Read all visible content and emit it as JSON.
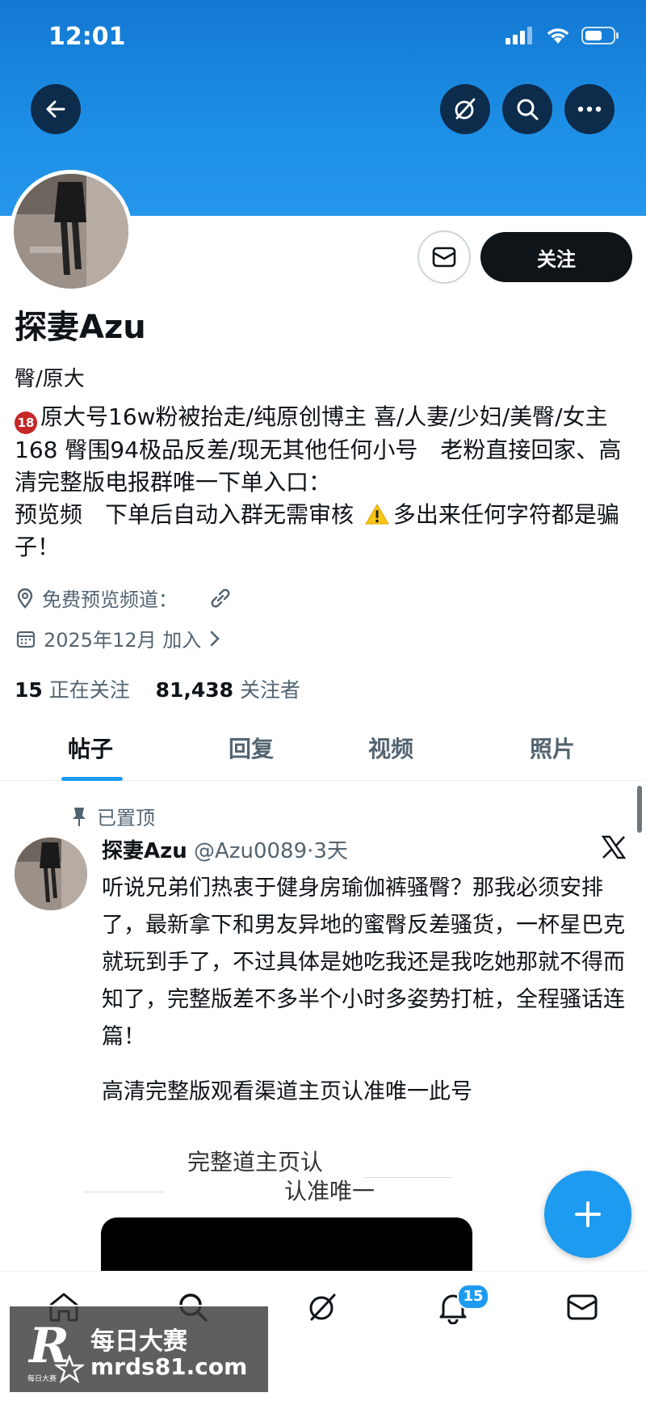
{
  "status_bar": {
    "time": "12:01"
  },
  "profile": {
    "display_name": "探妻Azu",
    "bio_line1": "臀/原大",
    "bio_age_badge": "18",
    "bio_part1": "原大号16w粉被抬走/纯原创博主 喜/人妻/少妇/美臀/女主168 臀围94极品反差/现无其他任何小号　老粉直接回家、高清完整版电报群唯一下单入口：",
    "bio_part2": "预览频　下单后自动入群无需审核",
    "bio_part3": "多出来任何字符都是骗子！",
    "location": "免费预览频道：",
    "joined": "2025年12月 加入",
    "following_count": "15",
    "following_label": "正在关注",
    "followers_count": "81,438",
    "followers_label": "关注者",
    "follow_button": "关注"
  },
  "tabs": [
    "帖子",
    "回复",
    "视频",
    "照片"
  ],
  "post": {
    "pinned_label": "已置顶",
    "name": "探妻Azu",
    "handle_time": "@Azu0089·3天",
    "text": "听说兄弟们热衷于健身房瑜伽裤骚臀？那我必须安排了，最新拿下和男友异地的蜜臀反差骚货，一杯星巴克就玩到手了，不过具体是她吃我还是我吃她那就不得而知了，完整版差不多半个小时多姿势打桩，全程骚话连篇！",
    "extra": "高清完整版观看渠道主页认准唯一此号",
    "media_text1": "完整道主页认",
    "media_text2": "认准唯一"
  },
  "nav": {
    "notifications_badge": "15"
  },
  "watermark": {
    "letter": "R",
    "line1": "每日大赛",
    "line2": "mrds81.com",
    "small": "每日大赛"
  },
  "colors": {
    "banner": "#1d8fe6",
    "accent": "#1d9bf0",
    "text": "#0f1419",
    "muted": "#536471"
  }
}
